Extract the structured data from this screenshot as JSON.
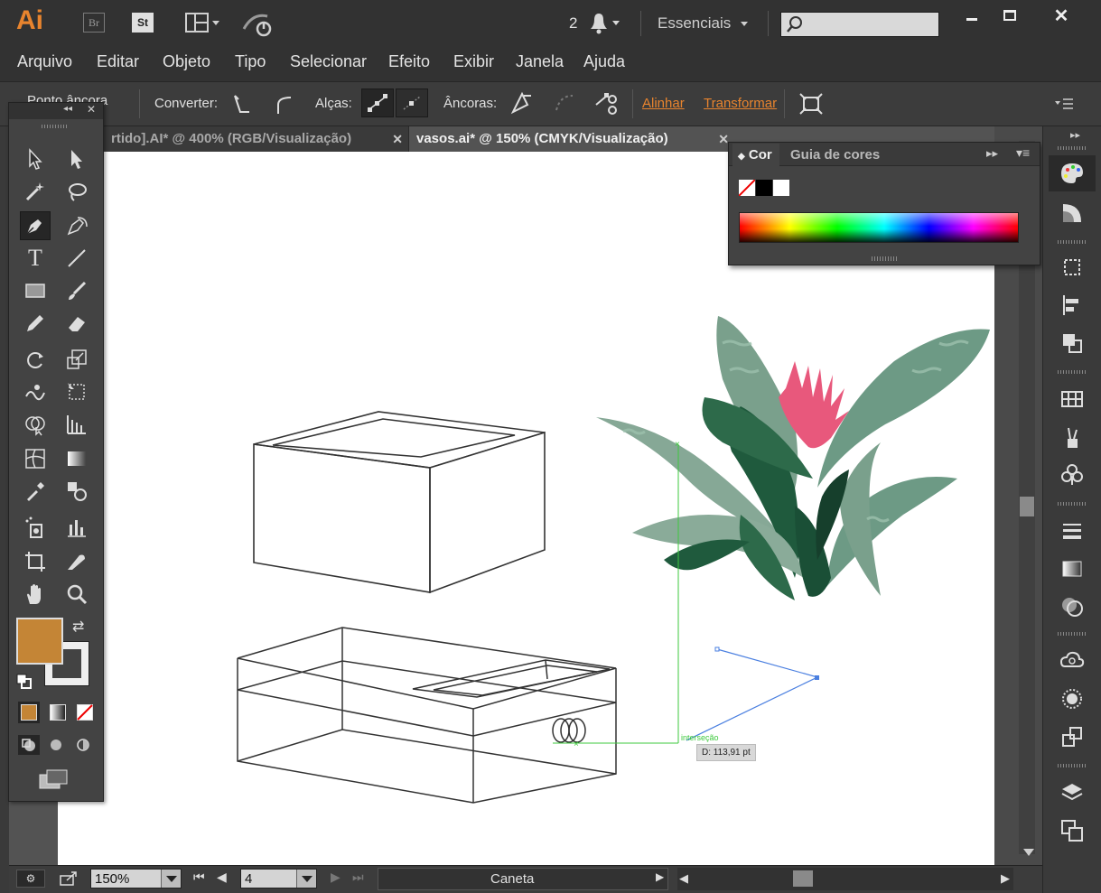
{
  "app": {
    "logo": "Ai",
    "bridge_label": "Br",
    "stock_label": "St",
    "notifications_count": "2",
    "workspace": "Essenciais",
    "search_placeholder": ""
  },
  "menu": [
    "Arquivo",
    "Editar",
    "Objeto",
    "Tipo",
    "Selecionar",
    "Efeito",
    "Exibir",
    "Janela",
    "Ajuda"
  ],
  "control_bar": {
    "anchor_label": "Ponto âncora",
    "convert_label": "Converter:",
    "handles_label": "Alças:",
    "anchors_label": "Âncoras:",
    "align_link": "Alinhar",
    "transform_link": "Transformar"
  },
  "tabs": [
    {
      "label": "rtido].AI* @ 400% (RGB/Visualização)",
      "active": false
    },
    {
      "label": "vasos.ai* @ 150% (CMYK/Visualização)",
      "active": true
    }
  ],
  "color_panel": {
    "tab_color": "Cor",
    "tab_guide": "Guia de cores",
    "fill_color": "#c48536"
  },
  "smart_guides": {
    "intersection_label": "interseção",
    "distance_readout": "D: 113,91 pt"
  },
  "status": {
    "zoom": "150%",
    "artboard": "4",
    "current_tool": "Caneta"
  },
  "colors": {
    "box_face": "#c48536",
    "guide_green": "#3ec93e",
    "path_blue": "#4a7fe0",
    "accent_orange": "#e8842e"
  }
}
